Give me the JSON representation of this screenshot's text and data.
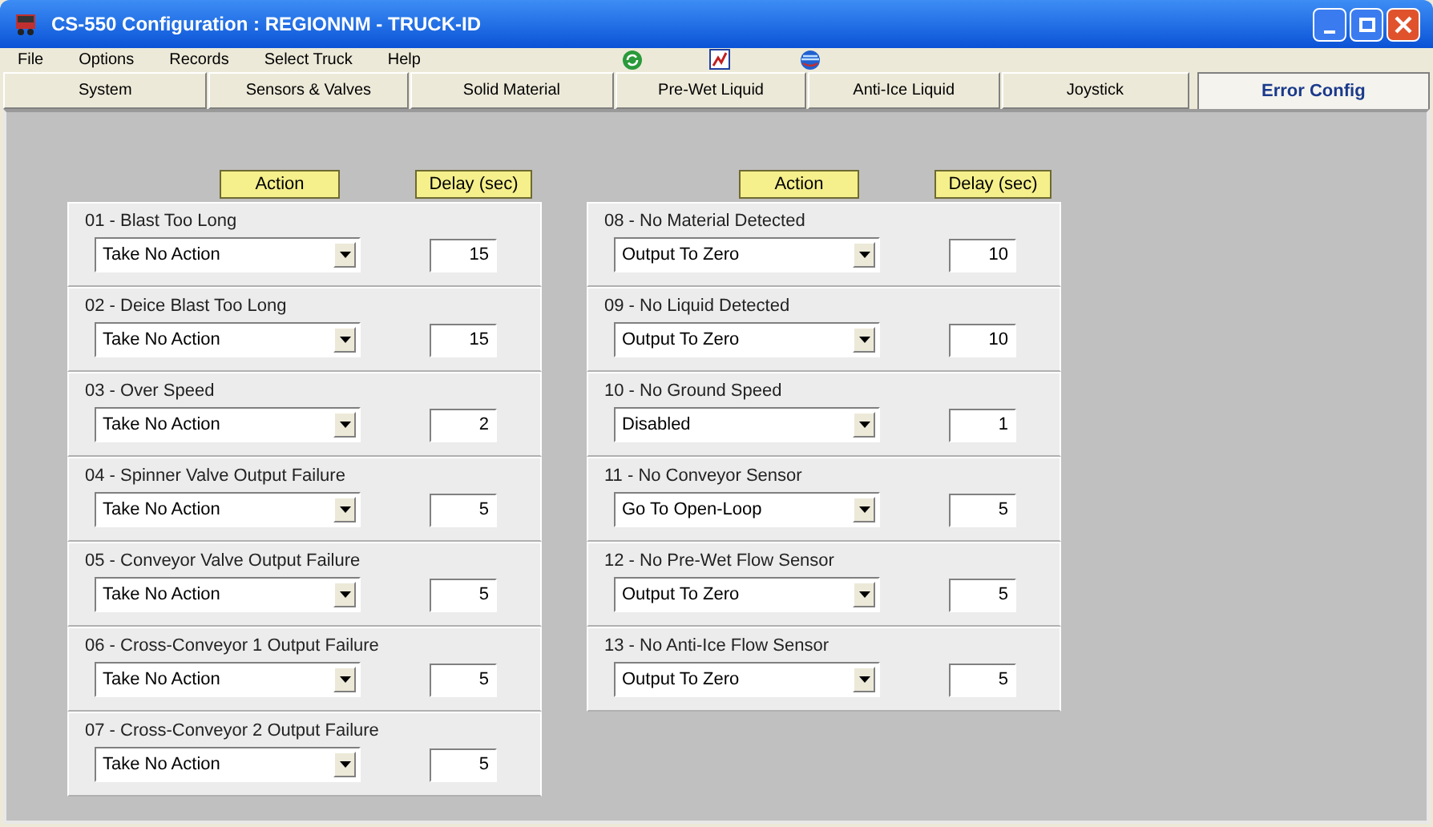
{
  "window": {
    "title": "CS-550 Configuration : REGIONNM - TRUCK-ID"
  },
  "menu": [
    "File",
    "Options",
    "Records",
    "Select Truck",
    "Help"
  ],
  "tabs": [
    {
      "label": "System",
      "selected": false
    },
    {
      "label": "Sensors & Valves",
      "selected": false
    },
    {
      "label": "Solid Material",
      "selected": false
    },
    {
      "label": "Pre-Wet Liquid",
      "selected": false
    },
    {
      "label": "Anti-Ice Liquid",
      "selected": false
    },
    {
      "label": "Joystick",
      "selected": false
    },
    {
      "label": "Error Config",
      "selected": true
    }
  ],
  "columns": [
    {
      "action_header": "Action",
      "delay_header": "Delay (sec)",
      "errors": [
        {
          "title": "01 - Blast Too Long",
          "action": "Take No Action",
          "delay": "15"
        },
        {
          "title": "02 - Deice Blast Too Long",
          "action": "Take No Action",
          "delay": "15"
        },
        {
          "title": "03 - Over Speed",
          "action": "Take No Action",
          "delay": "2"
        },
        {
          "title": "04 - Spinner Valve Output Failure",
          "action": "Take No Action",
          "delay": "5"
        },
        {
          "title": "05 - Conveyor Valve Output Failure",
          "action": "Take No Action",
          "delay": "5"
        },
        {
          "title": "06 - Cross-Conveyor 1 Output Failure",
          "action": "Take No Action",
          "delay": "5"
        },
        {
          "title": "07 - Cross-Conveyor 2 Output Failure",
          "action": "Take No Action",
          "delay": "5"
        }
      ]
    },
    {
      "action_header": "Action",
      "delay_header": "Delay (sec)",
      "errors": [
        {
          "title": "08 - No Material Detected",
          "action": "Output To Zero",
          "delay": "10"
        },
        {
          "title": "09 - No Liquid Detected",
          "action": "Output To Zero",
          "delay": "10"
        },
        {
          "title": "10 - No Ground Speed",
          "action": "Disabled",
          "delay": "1"
        },
        {
          "title": "11 - No Conveyor Sensor",
          "action": "Go To Open-Loop",
          "delay": "5"
        },
        {
          "title": "12 - No Pre-Wet Flow Sensor",
          "action": "Output To Zero",
          "delay": "5"
        },
        {
          "title": "13 - No Anti-Ice Flow Sensor",
          "action": "Output To Zero",
          "delay": "5"
        }
      ]
    }
  ]
}
